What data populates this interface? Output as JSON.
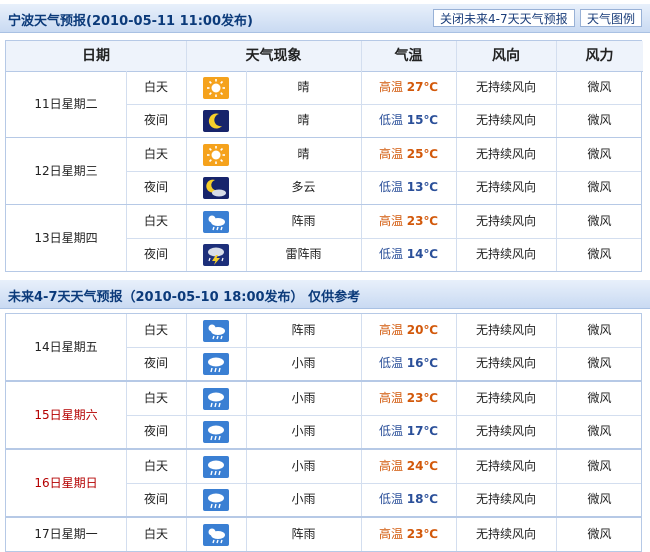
{
  "header1": {
    "title": "宁波天气预报(2010-05-11  11:00发布)",
    "btn_close": "关闭未来4-7天天气预报",
    "btn_legend": "天气图例"
  },
  "columns": [
    "日期",
    "天气现象",
    "气温",
    "风向",
    "风力"
  ],
  "days1": [
    {
      "date": "11日星期二",
      "red": false,
      "rows": [
        {
          "period": "白天",
          "icon": "sun-icon",
          "weather": "晴",
          "temp_label": "高温",
          "temp": "27℃",
          "wind_dir": "无持续风向",
          "wind_force": "微风"
        },
        {
          "period": "夜间",
          "icon": "moon-icon",
          "weather": "晴",
          "temp_label": "低温",
          "temp": "15℃",
          "wind_dir": "无持续风向",
          "wind_force": "微风"
        }
      ]
    },
    {
      "date": "12日星期三",
      "red": false,
      "rows": [
        {
          "period": "白天",
          "icon": "sun-icon",
          "weather": "晴",
          "temp_label": "高温",
          "temp": "25℃",
          "wind_dir": "无持续风向",
          "wind_force": "微风"
        },
        {
          "period": "夜间",
          "icon": "moon-cloud-icon",
          "weather": "多云",
          "temp_label": "低温",
          "temp": "13℃",
          "wind_dir": "无持续风向",
          "wind_force": "微风"
        }
      ]
    },
    {
      "date": "13日星期四",
      "red": false,
      "rows": [
        {
          "period": "白天",
          "icon": "sun-rain-icon",
          "weather": "阵雨",
          "temp_label": "高温",
          "temp": "23℃",
          "wind_dir": "无持续风向",
          "wind_force": "微风"
        },
        {
          "period": "夜间",
          "icon": "thunderstorm-icon",
          "weather": "雷阵雨",
          "temp_label": "低温",
          "temp": "14℃",
          "wind_dir": "无持续风向",
          "wind_force": "微风"
        }
      ]
    }
  ],
  "header2": {
    "title": "未来4-7天天气预报（2010-05-10 18:00发布）   仅供参考"
  },
  "days2": [
    {
      "date": "14日星期五",
      "red": false,
      "rows": [
        {
          "period": "白天",
          "icon": "sun-rain-icon",
          "weather": "阵雨",
          "temp_label": "高温",
          "temp": "20℃",
          "wind_dir": "无持续风向",
          "wind_force": "微风"
        },
        {
          "period": "夜间",
          "icon": "rain-icon",
          "weather": "小雨",
          "temp_label": "低温",
          "temp": "16℃",
          "wind_dir": "无持续风向",
          "wind_force": "微风"
        }
      ]
    },
    {
      "date": "15日星期六",
      "red": true,
      "rows": [
        {
          "period": "白天",
          "icon": "rain-icon",
          "weather": "小雨",
          "temp_label": "高温",
          "temp": "23℃",
          "wind_dir": "无持续风向",
          "wind_force": "微风"
        },
        {
          "period": "夜间",
          "icon": "rain-icon",
          "weather": "小雨",
          "temp_label": "低温",
          "temp": "17℃",
          "wind_dir": "无持续风向",
          "wind_force": "微风"
        }
      ]
    },
    {
      "date": "16日星期日",
      "red": true,
      "rows": [
        {
          "period": "白天",
          "icon": "rain-icon",
          "weather": "小雨",
          "temp_label": "高温",
          "temp": "24℃",
          "wind_dir": "无持续风向",
          "wind_force": "微风"
        },
        {
          "period": "夜间",
          "icon": "rain-icon",
          "weather": "小雨",
          "temp_label": "低温",
          "temp": "18℃",
          "wind_dir": "无持续风向",
          "wind_force": "微风"
        }
      ]
    },
    {
      "date": "17日星期一",
      "red": false,
      "rows": [
        {
          "period": "白天",
          "icon": "sun-rain-icon",
          "weather": "阵雨",
          "temp_label": "高温",
          "temp": "23℃",
          "wind_dir": "无持续风向",
          "wind_force": "微风"
        }
      ]
    }
  ]
}
